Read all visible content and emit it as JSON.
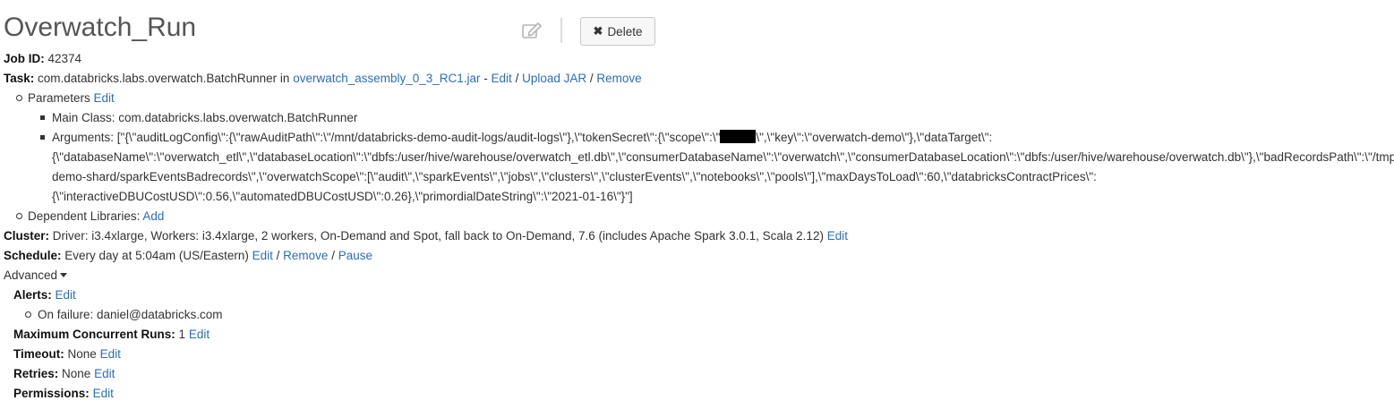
{
  "job": {
    "title": "Overwatch_Run",
    "delete_label": "Delete",
    "job_id_label": "Job ID:",
    "job_id": "42374",
    "task_label": "Task:",
    "task_class": "com.databricks.labs.overwatch.BatchRunner in",
    "task_jar": "overwatch_assembly_0_3_RC1.jar",
    "task_sep1": " - ",
    "task_edit": "Edit",
    "task_sep2": " / ",
    "task_upload": "Upload JAR",
    "task_sep3": " / ",
    "task_remove": "Remove"
  },
  "parameters": {
    "label": "Parameters",
    "edit": "Edit",
    "main_class": "Main Class: com.databricks.labs.overwatch.BatchRunner",
    "arguments_line1_a": "Arguments: [\"{\\\"auditLogConfig\\\":{\\\"rawAuditPath\\\":\\\"/mnt/databricks-demo-audit-logs/audit-logs\\\"},\\\"tokenSecret\\\":{\\\"scope\\\":\\\"",
    "arguments_line1_b": "\\\",\\\"key\\\":\\\"overwatch-demo\\\"},\\\"dataTarget\\\":",
    "arguments_line2": "{\\\"databaseName\\\":\\\"overwatch_etl\\\",\\\"databaseLocation\\\":\\\"dbfs:/user/hive/warehouse/overwatch_etl.db\\\",\\\"consumerDatabaseName\\\":\\\"overwatch\\\",\\\"consumerDatabaseLocation\\\":\\\"dbfs:/user/hive/warehouse/overwatch.db\\\"},\\\"badRecordsPath\\\":\\\"/tmp/overwatch/",
    "arguments_line3": "demo-shard/sparkEventsBadrecords\\\",\\\"overwatchScope\\\":[\\\"audit\\\",\\\"sparkEvents\\\",\\\"jobs\\\",\\\"clusters\\\",\\\"clusterEvents\\\",\\\"notebooks\\\",\\\"pools\\\"],\\\"maxDaysToLoad\\\":60,\\\"databricksContractPrices\\\":",
    "arguments_line4": "{\\\"interactiveDBUCostUSD\\\":0.56,\\\"automatedDBUCostUSD\\\":0.26},\\\"primordialDateString\\\":\\\"2021-01-16\\\"}\"]"
  },
  "dependent_libraries": {
    "label": "Dependent Libraries:",
    "add": "Add"
  },
  "cluster": {
    "label": "Cluster:",
    "text": "Driver: i3.4xlarge, Workers: i3.4xlarge, 2 workers, On-Demand and Spot, fall back to On-Demand, 7.6 (includes Apache Spark 3.0.1, Scala 2.12)",
    "edit": "Edit"
  },
  "schedule": {
    "label": "Schedule:",
    "text": "Every day at 5:04am (US/Eastern)",
    "edit": "Edit",
    "sep1": " / ",
    "remove": "Remove",
    "sep2": " / ",
    "pause": "Pause"
  },
  "advanced": {
    "label": "Advanced",
    "alerts_label": "Alerts:",
    "alerts_edit": "Edit",
    "on_failure": "On failure: daniel@databricks.com",
    "max_runs_label": "Maximum Concurrent Runs:",
    "max_runs_value": "1",
    "max_runs_edit": "Edit",
    "timeout_label": "Timeout:",
    "timeout_value": "None",
    "timeout_edit": "Edit",
    "retries_label": "Retries:",
    "retries_value": "None",
    "retries_edit": "Edit",
    "permissions_label": "Permissions:",
    "permissions_edit": "Edit"
  },
  "icons": {
    "edit_title": "pencil-edit-icon",
    "delete": "close-x-icon",
    "advanced_toggle": "caret-down-icon"
  }
}
